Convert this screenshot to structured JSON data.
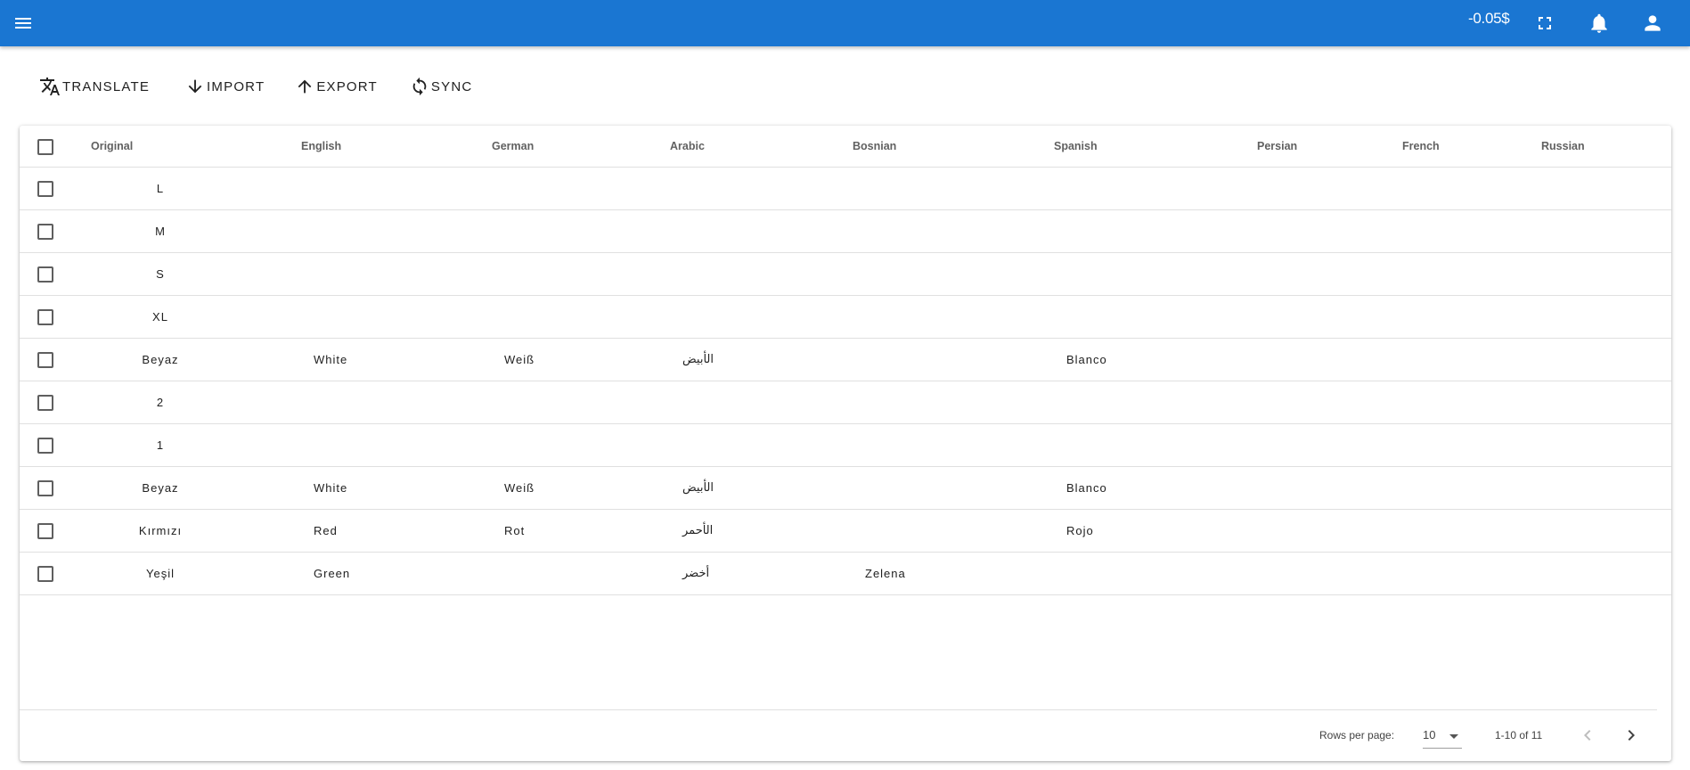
{
  "header": {
    "balance": "-0.05$",
    "icons": [
      "menu-icon",
      "fullscreen-icon",
      "bell-icon",
      "account-icon"
    ],
    "color": "#1a76d2"
  },
  "toolbar": {
    "translate_label": "TRANSLATE",
    "import_label": "IMPORT",
    "export_label": "EXPORT",
    "sync_label": "SYNC"
  },
  "table": {
    "columns": [
      "Original",
      "English",
      "German",
      "Arabic",
      "Bosnian",
      "Spanish",
      "Persian",
      "French",
      "Russian"
    ],
    "rows": [
      [
        "L",
        "",
        "",
        "",
        "",
        "",
        "",
        "",
        ""
      ],
      [
        "M",
        "",
        "",
        "",
        "",
        "",
        "",
        "",
        ""
      ],
      [
        "S",
        "",
        "",
        "",
        "",
        "",
        "",
        "",
        ""
      ],
      [
        "XL",
        "",
        "",
        "",
        "",
        "",
        "",
        "",
        ""
      ],
      [
        "Beyaz",
        "White",
        "Weiß",
        "الأبيض",
        "",
        "Blanco",
        "",
        "",
        ""
      ],
      [
        "2",
        "",
        "",
        "",
        "",
        "",
        "",
        "",
        ""
      ],
      [
        "1",
        "",
        "",
        "",
        "",
        "",
        "",
        "",
        ""
      ],
      [
        "Beyaz",
        "White",
        "Weiß",
        "الأبيض",
        "",
        "Blanco",
        "",
        "",
        ""
      ],
      [
        "Kırmızı",
        "Red",
        "Rot",
        "الأحمر",
        "",
        "Rojo",
        "",
        "",
        ""
      ],
      [
        "Yeşil",
        "Green",
        "",
        "أخضر",
        "Zelena",
        "",
        "",
        "",
        ""
      ]
    ]
  },
  "pagination": {
    "rows_per_page_label": "Rows per page:",
    "rows_per_page_value": "10",
    "range_text": "1-10 of 11"
  }
}
